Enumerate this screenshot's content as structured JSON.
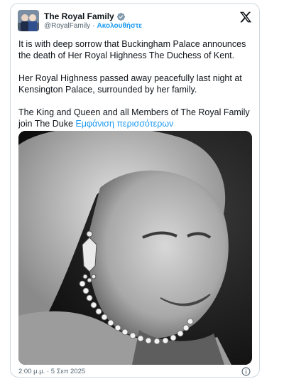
{
  "tweet": {
    "account_name": "The Royal Family",
    "handle": "@RoyalFamily",
    "separator": "·",
    "follow_label": "Ακολουθήστε",
    "paragraphs": [
      "It is with deep sorrow that Buckingham Palace announces the death of Her Royal Highness The Duchess of Kent.",
      "Her Royal Highness passed away peacefully last night at Kensington Palace, surrounded by her family."
    ],
    "paragraph3_text": "The King and Queen and all Members of The Royal Family join The Duke ",
    "show_more_label": "Εμφάνιση περισσότερων",
    "timestamp": "2:00 μ.μ. · 5 Σεπ 2025"
  },
  "icons": {
    "verified": "verified-badge-icon",
    "platform": "x-logo-icon",
    "info": "info-icon"
  },
  "colors": {
    "link_blue": "#1d9bf0",
    "text_primary": "#0f1419",
    "text_secondary": "#536471",
    "border": "#cfd9de"
  }
}
